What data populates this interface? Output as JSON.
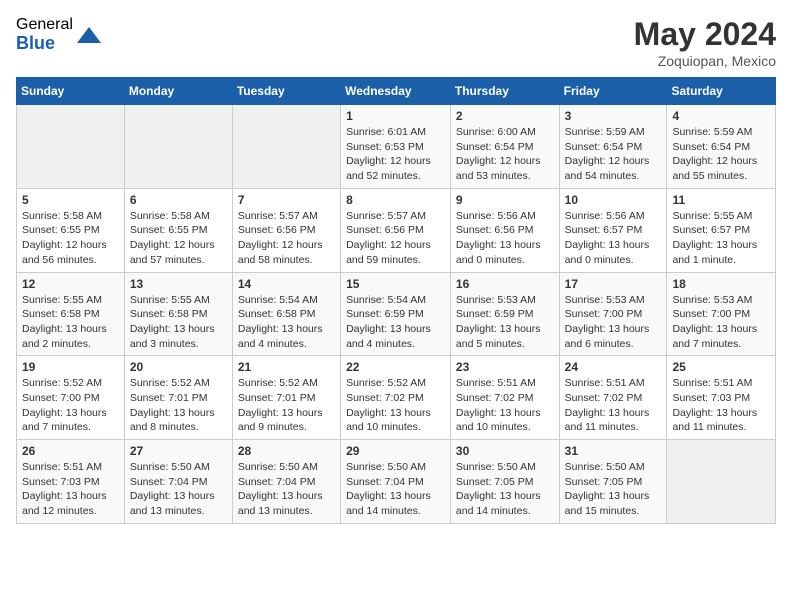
{
  "header": {
    "logo_general": "General",
    "logo_blue": "Blue",
    "month_title": "May 2024",
    "location": "Zoquiopan, Mexico"
  },
  "weekdays": [
    "Sunday",
    "Monday",
    "Tuesday",
    "Wednesday",
    "Thursday",
    "Friday",
    "Saturday"
  ],
  "weeks": [
    [
      {
        "day": "",
        "info": ""
      },
      {
        "day": "",
        "info": ""
      },
      {
        "day": "",
        "info": ""
      },
      {
        "day": "1",
        "info": "Sunrise: 6:01 AM\nSunset: 6:53 PM\nDaylight: 12 hours\nand 52 minutes."
      },
      {
        "day": "2",
        "info": "Sunrise: 6:00 AM\nSunset: 6:54 PM\nDaylight: 12 hours\nand 53 minutes."
      },
      {
        "day": "3",
        "info": "Sunrise: 5:59 AM\nSunset: 6:54 PM\nDaylight: 12 hours\nand 54 minutes."
      },
      {
        "day": "4",
        "info": "Sunrise: 5:59 AM\nSunset: 6:54 PM\nDaylight: 12 hours\nand 55 minutes."
      }
    ],
    [
      {
        "day": "5",
        "info": "Sunrise: 5:58 AM\nSunset: 6:55 PM\nDaylight: 12 hours\nand 56 minutes."
      },
      {
        "day": "6",
        "info": "Sunrise: 5:58 AM\nSunset: 6:55 PM\nDaylight: 12 hours\nand 57 minutes."
      },
      {
        "day": "7",
        "info": "Sunrise: 5:57 AM\nSunset: 6:56 PM\nDaylight: 12 hours\nand 58 minutes."
      },
      {
        "day": "8",
        "info": "Sunrise: 5:57 AM\nSunset: 6:56 PM\nDaylight: 12 hours\nand 59 minutes."
      },
      {
        "day": "9",
        "info": "Sunrise: 5:56 AM\nSunset: 6:56 PM\nDaylight: 13 hours\nand 0 minutes."
      },
      {
        "day": "10",
        "info": "Sunrise: 5:56 AM\nSunset: 6:57 PM\nDaylight: 13 hours\nand 0 minutes."
      },
      {
        "day": "11",
        "info": "Sunrise: 5:55 AM\nSunset: 6:57 PM\nDaylight: 13 hours\nand 1 minute."
      }
    ],
    [
      {
        "day": "12",
        "info": "Sunrise: 5:55 AM\nSunset: 6:58 PM\nDaylight: 13 hours\nand 2 minutes."
      },
      {
        "day": "13",
        "info": "Sunrise: 5:55 AM\nSunset: 6:58 PM\nDaylight: 13 hours\nand 3 minutes."
      },
      {
        "day": "14",
        "info": "Sunrise: 5:54 AM\nSunset: 6:58 PM\nDaylight: 13 hours\nand 4 minutes."
      },
      {
        "day": "15",
        "info": "Sunrise: 5:54 AM\nSunset: 6:59 PM\nDaylight: 13 hours\nand 4 minutes."
      },
      {
        "day": "16",
        "info": "Sunrise: 5:53 AM\nSunset: 6:59 PM\nDaylight: 13 hours\nand 5 minutes."
      },
      {
        "day": "17",
        "info": "Sunrise: 5:53 AM\nSunset: 7:00 PM\nDaylight: 13 hours\nand 6 minutes."
      },
      {
        "day": "18",
        "info": "Sunrise: 5:53 AM\nSunset: 7:00 PM\nDaylight: 13 hours\nand 7 minutes."
      }
    ],
    [
      {
        "day": "19",
        "info": "Sunrise: 5:52 AM\nSunset: 7:00 PM\nDaylight: 13 hours\nand 7 minutes."
      },
      {
        "day": "20",
        "info": "Sunrise: 5:52 AM\nSunset: 7:01 PM\nDaylight: 13 hours\nand 8 minutes."
      },
      {
        "day": "21",
        "info": "Sunrise: 5:52 AM\nSunset: 7:01 PM\nDaylight: 13 hours\nand 9 minutes."
      },
      {
        "day": "22",
        "info": "Sunrise: 5:52 AM\nSunset: 7:02 PM\nDaylight: 13 hours\nand 10 minutes."
      },
      {
        "day": "23",
        "info": "Sunrise: 5:51 AM\nSunset: 7:02 PM\nDaylight: 13 hours\nand 10 minutes."
      },
      {
        "day": "24",
        "info": "Sunrise: 5:51 AM\nSunset: 7:02 PM\nDaylight: 13 hours\nand 11 minutes."
      },
      {
        "day": "25",
        "info": "Sunrise: 5:51 AM\nSunset: 7:03 PM\nDaylight: 13 hours\nand 11 minutes."
      }
    ],
    [
      {
        "day": "26",
        "info": "Sunrise: 5:51 AM\nSunset: 7:03 PM\nDaylight: 13 hours\nand 12 minutes."
      },
      {
        "day": "27",
        "info": "Sunrise: 5:50 AM\nSunset: 7:04 PM\nDaylight: 13 hours\nand 13 minutes."
      },
      {
        "day": "28",
        "info": "Sunrise: 5:50 AM\nSunset: 7:04 PM\nDaylight: 13 hours\nand 13 minutes."
      },
      {
        "day": "29",
        "info": "Sunrise: 5:50 AM\nSunset: 7:04 PM\nDaylight: 13 hours\nand 14 minutes."
      },
      {
        "day": "30",
        "info": "Sunrise: 5:50 AM\nSunset: 7:05 PM\nDaylight: 13 hours\nand 14 minutes."
      },
      {
        "day": "31",
        "info": "Sunrise: 5:50 AM\nSunset: 7:05 PM\nDaylight: 13 hours\nand 15 minutes."
      },
      {
        "day": "",
        "info": ""
      }
    ]
  ]
}
